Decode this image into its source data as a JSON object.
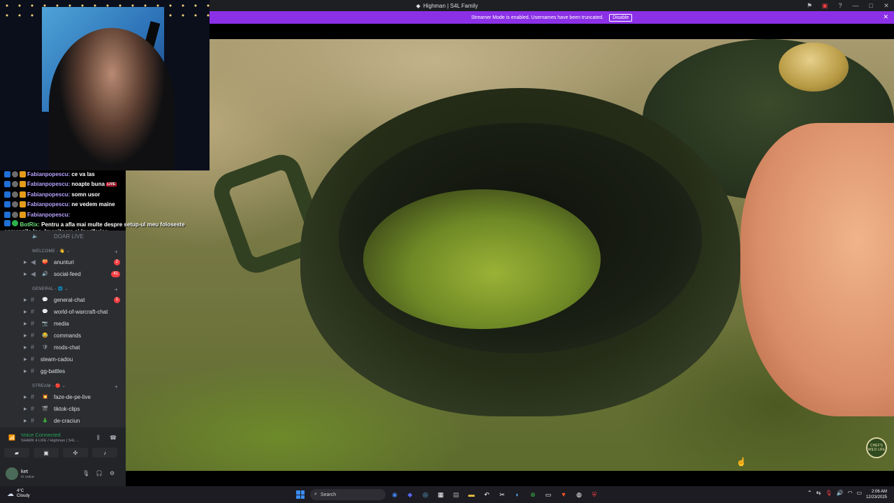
{
  "window": {
    "title": "Highman | S4L Family"
  },
  "banner": {
    "text": "Streamer Mode is enabled. Usernames have been truncated.",
    "button": "Disable"
  },
  "chat": [
    {
      "user": "Fabianpopescu:",
      "message": "ce va las",
      "badges": [
        "blue",
        "gray",
        "orange"
      ]
    },
    {
      "user": "Fabianpopescu:",
      "message": "noapte buna",
      "badges": [
        "blue",
        "gray",
        "orange"
      ]
    },
    {
      "user": "Fabianpopescu:",
      "message": "somn usor",
      "badges": [
        "blue",
        "gray",
        "orange"
      ]
    },
    {
      "user": "Fabianpopescu:",
      "message": "ne vedem maine",
      "badges": [
        "blue",
        "gray",
        "orange"
      ]
    },
    {
      "user": "Fabianpopescu:",
      "message": "",
      "badges": [
        "blue",
        "gray",
        "orange"
      ]
    },
    {
      "user": "BotRix:",
      "message": "Pentru a afla mai multe despre setup-ul meu foloseste comenzile !pc, !monitoare si !periferice",
      "badges": [
        "blue",
        "green"
      ]
    }
  ],
  "live_badge": "LIVE",
  "channels": {
    "voice_item": "DOAR LIVE",
    "categories": [
      {
        "name": "WELCOME",
        "emoji": "👋"
      },
      {
        "name": "GENERAL",
        "emoji": "🌐"
      },
      {
        "name": "STREAM",
        "emoji": "🔴"
      }
    ],
    "items": [
      {
        "name": "anunturi",
        "emoji": "🍑",
        "count": "2"
      },
      {
        "name": "social-feed",
        "emoji": "🔊",
        "count": "41"
      },
      {
        "name": "general-chat",
        "emoji": "💬",
        "count": "1"
      },
      {
        "name": "world-of-warcraft-chat",
        "emoji": "💬",
        "count": ""
      },
      {
        "name": "media",
        "emoji": "📷",
        "count": ""
      },
      {
        "name": "commands",
        "emoji": "😂",
        "count": ""
      },
      {
        "name": "mods-chat",
        "emoji": "🛡",
        "count": ""
      },
      {
        "name": "steam-cadou",
        "emoji": "",
        "count": ""
      },
      {
        "name": "gg-battles",
        "emoji": "",
        "count": ""
      },
      {
        "name": "faze-de-pe-live",
        "emoji": "💥",
        "count": ""
      },
      {
        "name": "tiktok-clips",
        "emoji": "🎬",
        "count": ""
      },
      {
        "name": "de-craciun",
        "emoji": "🎄",
        "count": ""
      }
    ]
  },
  "voice": {
    "status": "Voice Connected",
    "channel": "SHARK 4 LIFE / Highman | S4L ..."
  },
  "user": {
    "name": "ket",
    "status": "In voice"
  },
  "taskbar": {
    "weather_temp": "4°C",
    "weather_desc": "Cloudy",
    "search_placeholder": "Search",
    "time": "2:06 AM",
    "date": "12/23/2025"
  },
  "watermark_text": "CHEF'S WILD LIFE"
}
